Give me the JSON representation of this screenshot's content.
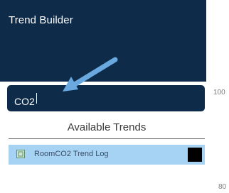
{
  "header": {
    "title": "Trend Builder"
  },
  "search": {
    "value": "CO2"
  },
  "available": {
    "title": "Available Trends",
    "items": [
      {
        "label": "RoomCO2 Trend Log",
        "checked": true,
        "swatch_color": "#000000"
      }
    ]
  },
  "axis": {
    "top_label": "100",
    "bottom_label": "80"
  },
  "colors": {
    "header_bg": "#0e2b4a",
    "selected_row": "#a6d3f3",
    "arrow": "#6aa9df"
  },
  "annotation": {
    "arrow_icon": "pointer-arrow-icon"
  }
}
